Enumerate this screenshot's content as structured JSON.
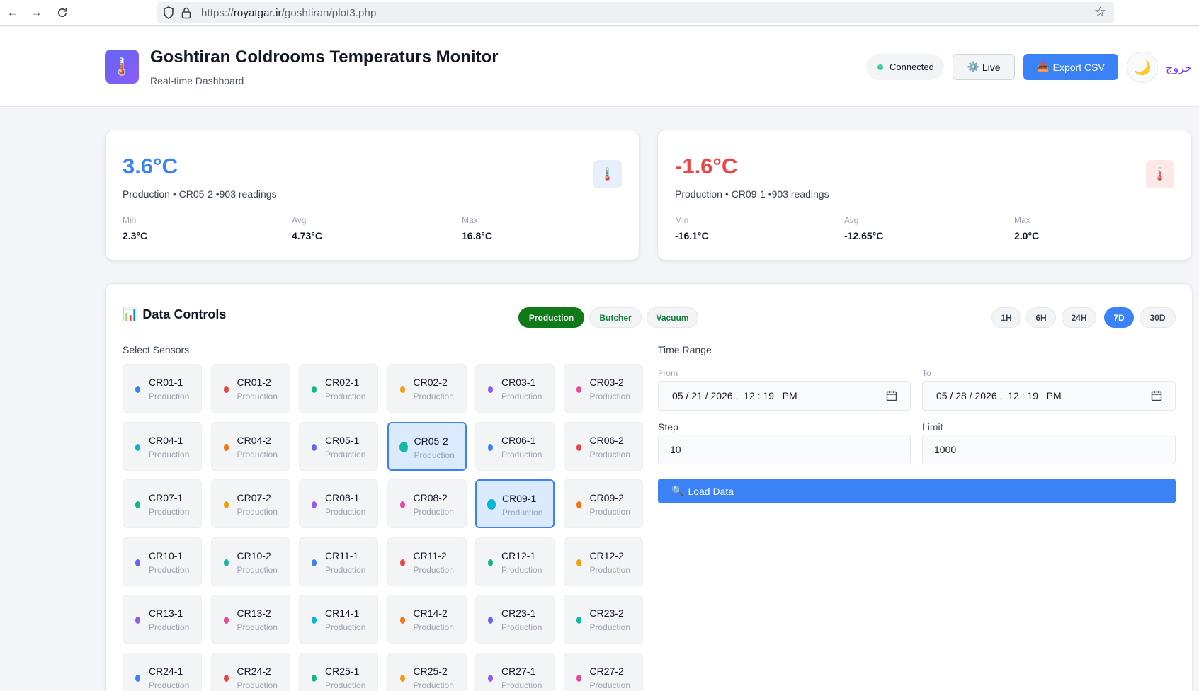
{
  "browser": {
    "url_scheme": "https://",
    "url_host": "royatgar.ir",
    "url_path": "/goshtiran/plot3.php"
  },
  "header": {
    "title": "Goshtiran Coldrooms Temperaturs Monitor",
    "subtitle": "Real-time Dashboard",
    "logo_icon": "🌡️",
    "status": "Connected",
    "live_icon": "⚙️",
    "live_label": "Live",
    "export_icon": "📥",
    "export_label": "Export CSV",
    "theme_icon": "🌙",
    "logout": "خروج"
  },
  "stats": [
    {
      "value": "3.6°C",
      "subtitle": "Production • CR05-2 •903 readings",
      "icon": "🌡️",
      "color": "#3b82f6",
      "min_label": "Min",
      "min": "2.3°C",
      "avg_label": "Avg",
      "avg": "4.73°C",
      "max_label": "Max",
      "max": "16.8°C"
    },
    {
      "value": "-1.6°C",
      "subtitle": "Production • CR09-1 •903 readings",
      "icon": "🌡️",
      "color": "#ef4444",
      "min_label": "Min",
      "min": "-16.1°C",
      "avg_label": "Avg",
      "avg": "-12.65°C",
      "max_label": "Max",
      "max": "2.0°C"
    }
  ],
  "controls": {
    "title_icon": "📊",
    "title": "Data Controls",
    "groups": [
      "Production",
      "Butcher",
      "Vacuum"
    ],
    "active_group": "Production",
    "ranges": [
      "1H",
      "6H",
      "24H",
      "7D",
      "30D"
    ],
    "active_range": "7D",
    "select_sensors_label": "Select Sensors",
    "time_range_label": "Time Range",
    "from_label": "From",
    "from_value": "05 / 21 / 2026 ,  12 : 19   PM",
    "to_label": "To",
    "to_value": "05 / 28 / 2026 ,  12 : 19   PM",
    "step_label": "Step",
    "step_value": "10",
    "limit_label": "Limit",
    "limit_value": "1000",
    "load_icon": "🔍",
    "load_label": "Load Data"
  },
  "sensors": [
    {
      "name": "CR01-1",
      "group": "Production",
      "color": "#3b82f6",
      "selected": false
    },
    {
      "name": "CR01-2",
      "group": "Production",
      "color": "#ef4444",
      "selected": false
    },
    {
      "name": "CR02-1",
      "group": "Production",
      "color": "#10b981",
      "selected": false
    },
    {
      "name": "CR02-2",
      "group": "Production",
      "color": "#f59e0b",
      "selected": false
    },
    {
      "name": "CR03-1",
      "group": "Production",
      "color": "#8b5cf6",
      "selected": false
    },
    {
      "name": "CR03-2",
      "group": "Production",
      "color": "#ec4899",
      "selected": false
    },
    {
      "name": "CR04-1",
      "group": "Production",
      "color": "#06b6d4",
      "selected": false
    },
    {
      "name": "CR04-2",
      "group": "Production",
      "color": "#f97316",
      "selected": false
    },
    {
      "name": "CR05-1",
      "group": "Production",
      "color": "#6366f1",
      "selected": false
    },
    {
      "name": "CR05-2",
      "group": "Production",
      "color": "#14b8a6",
      "selected": true
    },
    {
      "name": "CR06-1",
      "group": "Production",
      "color": "#3b82f6",
      "selected": false
    },
    {
      "name": "CR06-2",
      "group": "Production",
      "color": "#ef4444",
      "selected": false
    },
    {
      "name": "CR07-1",
      "group": "Production",
      "color": "#10b981",
      "selected": false
    },
    {
      "name": "CR07-2",
      "group": "Production",
      "color": "#f59e0b",
      "selected": false
    },
    {
      "name": "CR08-1",
      "group": "Production",
      "color": "#8b5cf6",
      "selected": false
    },
    {
      "name": "CR08-2",
      "group": "Production",
      "color": "#ec4899",
      "selected": false
    },
    {
      "name": "CR09-1",
      "group": "Production",
      "color": "#06b6d4",
      "selected": true
    },
    {
      "name": "CR09-2",
      "group": "Production",
      "color": "#f97316",
      "selected": false
    },
    {
      "name": "CR10-1",
      "group": "Production",
      "color": "#6366f1",
      "selected": false
    },
    {
      "name": "CR10-2",
      "group": "Production",
      "color": "#14b8a6",
      "selected": false
    },
    {
      "name": "CR11-1",
      "group": "Production",
      "color": "#3b82f6",
      "selected": false
    },
    {
      "name": "CR11-2",
      "group": "Production",
      "color": "#ef4444",
      "selected": false
    },
    {
      "name": "CR12-1",
      "group": "Production",
      "color": "#10b981",
      "selected": false
    },
    {
      "name": "CR12-2",
      "group": "Production",
      "color": "#f59e0b",
      "selected": false
    },
    {
      "name": "CR13-1",
      "group": "Production",
      "color": "#8b5cf6",
      "selected": false
    },
    {
      "name": "CR13-2",
      "group": "Production",
      "color": "#ec4899",
      "selected": false
    },
    {
      "name": "CR14-1",
      "group": "Production",
      "color": "#06b6d4",
      "selected": false
    },
    {
      "name": "CR14-2",
      "group": "Production",
      "color": "#f97316",
      "selected": false
    },
    {
      "name": "CR23-1",
      "group": "Production",
      "color": "#6366f1",
      "selected": false
    },
    {
      "name": "CR23-2",
      "group": "Production",
      "color": "#14b8a6",
      "selected": false
    },
    {
      "name": "CR24-1",
      "group": "Production",
      "color": "#3b82f6",
      "selected": false
    },
    {
      "name": "CR24-2",
      "group": "Production",
      "color": "#ef4444",
      "selected": false
    },
    {
      "name": "CR25-1",
      "group": "Production",
      "color": "#10b981",
      "selected": false
    },
    {
      "name": "CR25-2",
      "group": "Production",
      "color": "#f59e0b",
      "selected": false
    },
    {
      "name": "CR27-1",
      "group": "Production",
      "color": "#8b5cf6",
      "selected": false
    },
    {
      "name": "CR27-2",
      "group": "Production",
      "color": "#ec4899",
      "selected": false
    }
  ]
}
